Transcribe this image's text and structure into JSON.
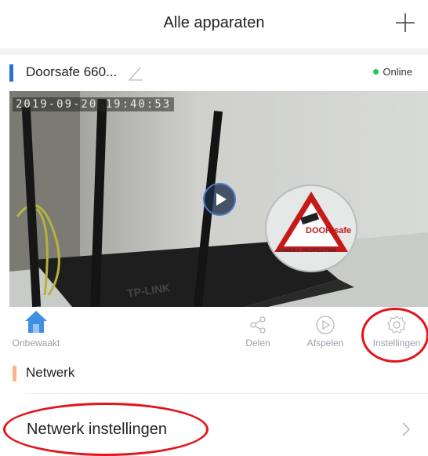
{
  "header": {
    "title": "Alle apparaten",
    "add_icon": "plus-icon"
  },
  "device": {
    "name": "Doorsafe 660...",
    "status": "Online",
    "status_color": "#22c55e",
    "accent_color": "#2f6fd6"
  },
  "video": {
    "timestamp": "2019-09-20 19:40:53",
    "sign_brand": "DOOR|safe",
    "sign_caption": "CAMERA PROTECTION",
    "router_label": "TP-LINK"
  },
  "toolbar": {
    "home_label": "Onbewaakt",
    "share_label": "Delen",
    "play_label": "Afspelen",
    "settings_label": "Instellingen"
  },
  "section": {
    "title": "Netwerk",
    "accent_color": "#f7b68a"
  },
  "network_settings": {
    "label": "Netwerk instellingen"
  },
  "highlight_color": "#e3141a"
}
